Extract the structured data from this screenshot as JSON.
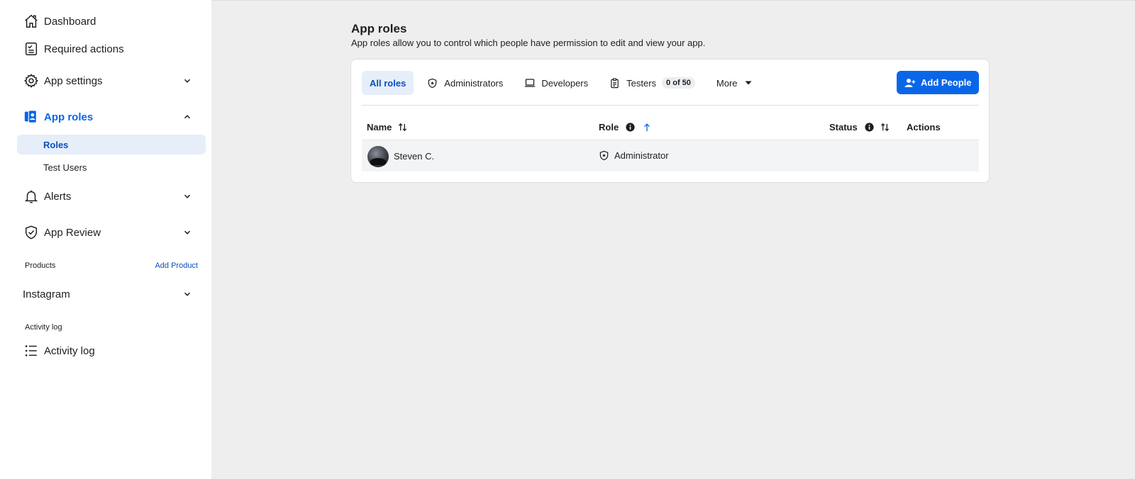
{
  "sidebar": {
    "dashboard": "Dashboard",
    "required_actions": "Required actions",
    "app_settings": "App settings",
    "app_roles": "App roles",
    "roles": "Roles",
    "test_users": "Test Users",
    "alerts": "Alerts",
    "app_review": "App Review",
    "products_label": "Products",
    "add_product": "Add Product",
    "instagram": "Instagram",
    "activity_section": "Activity log",
    "activity_log": "Activity log"
  },
  "header": {
    "title": "App roles",
    "description": "App roles allow you to control which people have permission to edit and view your app."
  },
  "tabs": {
    "all_roles": "All roles",
    "administrators": "Administrators",
    "developers": "Developers",
    "testers": "Testers",
    "testers_badge": "0 of 50",
    "more": "More"
  },
  "add_people_label": "Add People",
  "table": {
    "columns": {
      "name": "Name",
      "role": "Role",
      "status": "Status",
      "actions": "Actions"
    },
    "rows": [
      {
        "name": "Steven C.",
        "role": "Administrator"
      }
    ]
  },
  "colors": {
    "accent": "#0a66e8",
    "selected_bg": "#e6eefa",
    "page_bg": "#eeeeee"
  }
}
